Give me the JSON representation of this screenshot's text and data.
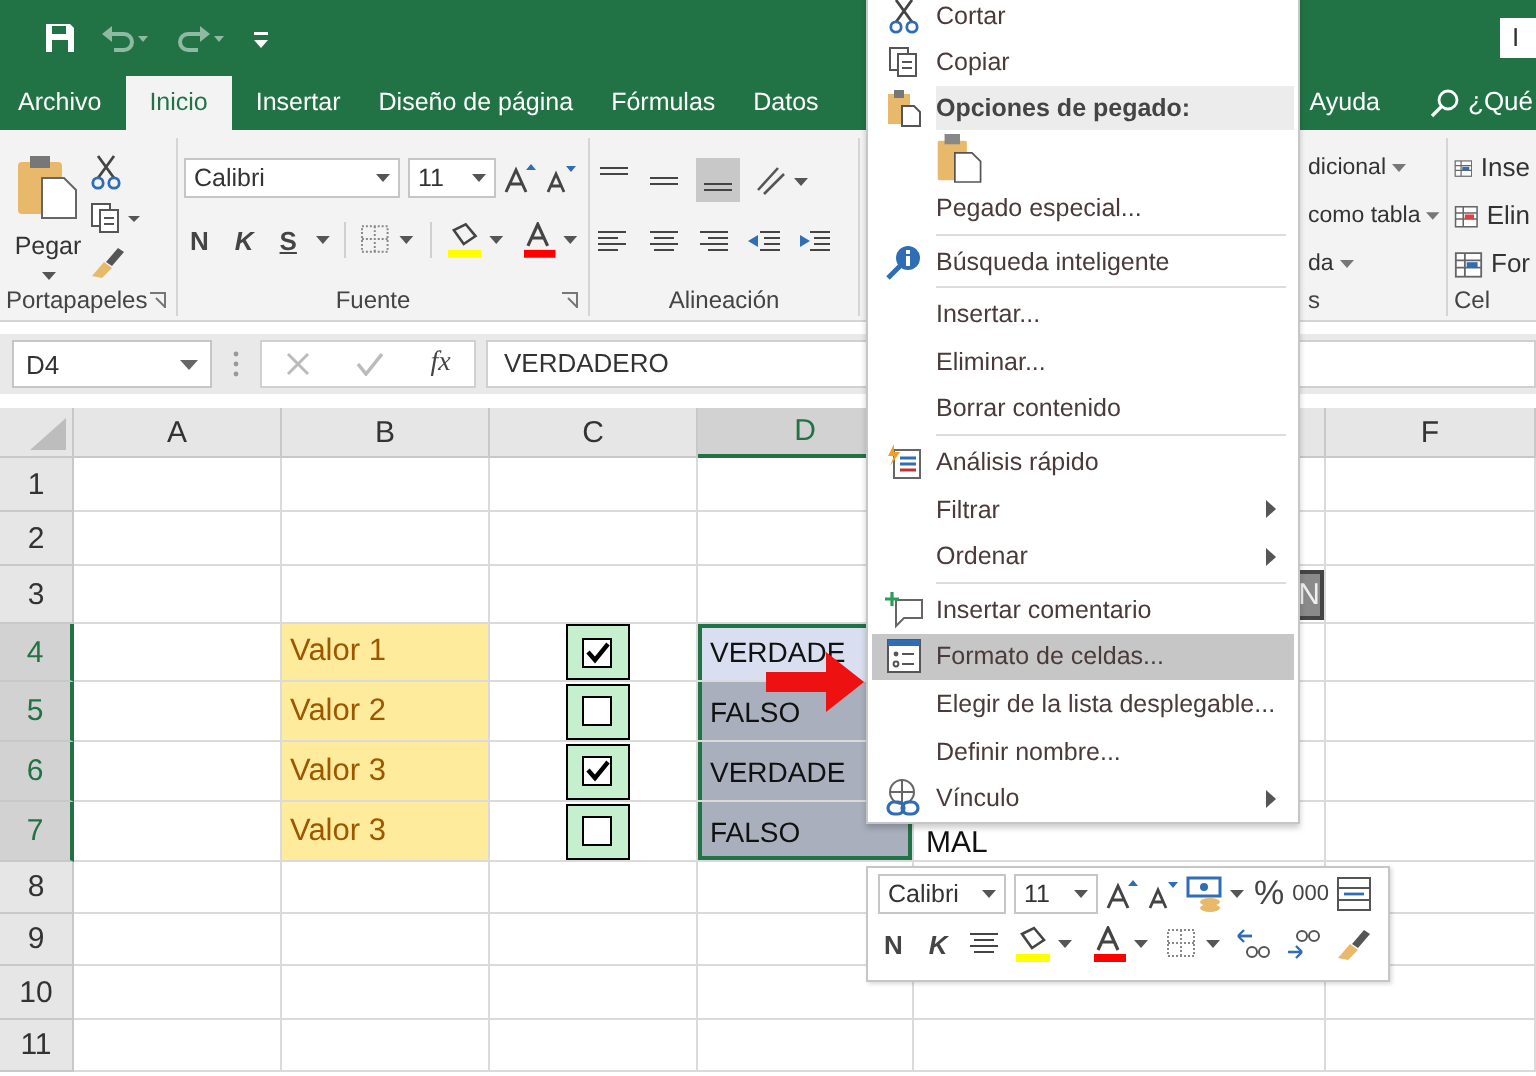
{
  "title_bar": {
    "sign_in": "I"
  },
  "tabs": [
    {
      "label": "Archivo",
      "selected": false
    },
    {
      "label": "Inicio",
      "selected": true
    },
    {
      "label": "Insertar",
      "selected": false
    },
    {
      "label": "Diseño de página",
      "selected": false
    },
    {
      "label": "Fórmulas",
      "selected": false
    },
    {
      "label": "Datos",
      "selected": false
    },
    {
      "label": "Ayuda",
      "selected": false
    }
  ],
  "tell_me": "¿Qué",
  "ribbon": {
    "clipboard": {
      "paste": "Pegar",
      "label": "Portapapeles"
    },
    "font": {
      "name": "Calibri",
      "size": "11",
      "bold": "N",
      "italic": "K",
      "underline": "S",
      "label": "Fuente"
    },
    "alignment": {
      "label": "Alineación"
    },
    "styles": {
      "items": [
        "dicional",
        "como tabla",
        "da"
      ],
      "label": "s"
    },
    "cells": {
      "items": [
        "Inse",
        "Elin",
        "For"
      ],
      "label": "Cel"
    }
  },
  "formula_bar": {
    "name_box": "D4",
    "function_label": "fx",
    "value": "VERDADERO"
  },
  "sheet": {
    "columns": [
      {
        "label": "A",
        "selected": false
      },
      {
        "label": "B",
        "selected": false
      },
      {
        "label": "C",
        "selected": false
      },
      {
        "label": "D",
        "selected": true
      },
      {
        "label": "F",
        "selected": false
      }
    ],
    "rows": [
      {
        "label": "1",
        "selected": false
      },
      {
        "label": "2",
        "selected": false
      },
      {
        "label": "3",
        "selected": false,
        "e": "N"
      },
      {
        "label": "4",
        "selected": true,
        "b": "Valor 1",
        "checkbox": {
          "checked": true
        },
        "d": "VERDADE",
        "active": true
      },
      {
        "label": "5",
        "selected": true,
        "b": "Valor 2",
        "checkbox": {
          "checked": false
        },
        "d": "FALSO",
        "active": false
      },
      {
        "label": "6",
        "selected": true,
        "b": "Valor 3",
        "checkbox": {
          "checked": true
        },
        "d": "VERDADE",
        "active": false
      },
      {
        "label": "7",
        "selected": true,
        "b": "Valor 3",
        "checkbox": {
          "checked": false
        },
        "d": "FALSO",
        "active": false,
        "e": "MAL"
      },
      {
        "label": "8",
        "selected": false
      },
      {
        "label": "9",
        "selected": false
      },
      {
        "label": "10",
        "selected": false
      },
      {
        "label": "11",
        "selected": false
      }
    ]
  },
  "context_menu": {
    "items": [
      {
        "kind": "item",
        "label": "Cortar",
        "selected": false,
        "submenu": false
      },
      {
        "kind": "item",
        "label": "Copiar",
        "selected": false,
        "submenu": false
      },
      {
        "kind": "header",
        "label": "Opciones de pegado:"
      },
      {
        "kind": "paste_icons"
      },
      {
        "kind": "item",
        "label": "Pegado especial...",
        "selected": false,
        "submenu": false
      },
      {
        "kind": "separator"
      },
      {
        "kind": "item",
        "label": "Búsqueda inteligente",
        "selected": false,
        "submenu": false
      },
      {
        "kind": "separator"
      },
      {
        "kind": "item",
        "label": "Insertar...",
        "selected": false,
        "submenu": false
      },
      {
        "kind": "item",
        "label": "Eliminar...",
        "selected": false,
        "submenu": false
      },
      {
        "kind": "item",
        "label": "Borrar contenido",
        "selected": false,
        "submenu": false
      },
      {
        "kind": "separator"
      },
      {
        "kind": "item",
        "label": "Análisis rápido",
        "selected": false,
        "submenu": false
      },
      {
        "kind": "item",
        "label": "Filtrar",
        "selected": false,
        "submenu": true
      },
      {
        "kind": "item",
        "label": "Ordenar",
        "selected": false,
        "submenu": true
      },
      {
        "kind": "separator"
      },
      {
        "kind": "item",
        "label": "Insertar comentario",
        "selected": false,
        "submenu": false
      },
      {
        "kind": "item",
        "label": "Formato de celdas...",
        "selected": true,
        "submenu": false
      },
      {
        "kind": "item",
        "label": "Elegir de la lista desplegable...",
        "selected": false,
        "submenu": false
      },
      {
        "kind": "item",
        "label": "Definir nombre...",
        "selected": false,
        "submenu": false
      },
      {
        "kind": "item",
        "label": "Vínculo",
        "selected": false,
        "submenu": true
      }
    ]
  },
  "mini_toolbar": {
    "font": "Calibri",
    "size": "11",
    "percent": "%",
    "thousands": "000",
    "bold": "N",
    "italic": "K"
  }
}
